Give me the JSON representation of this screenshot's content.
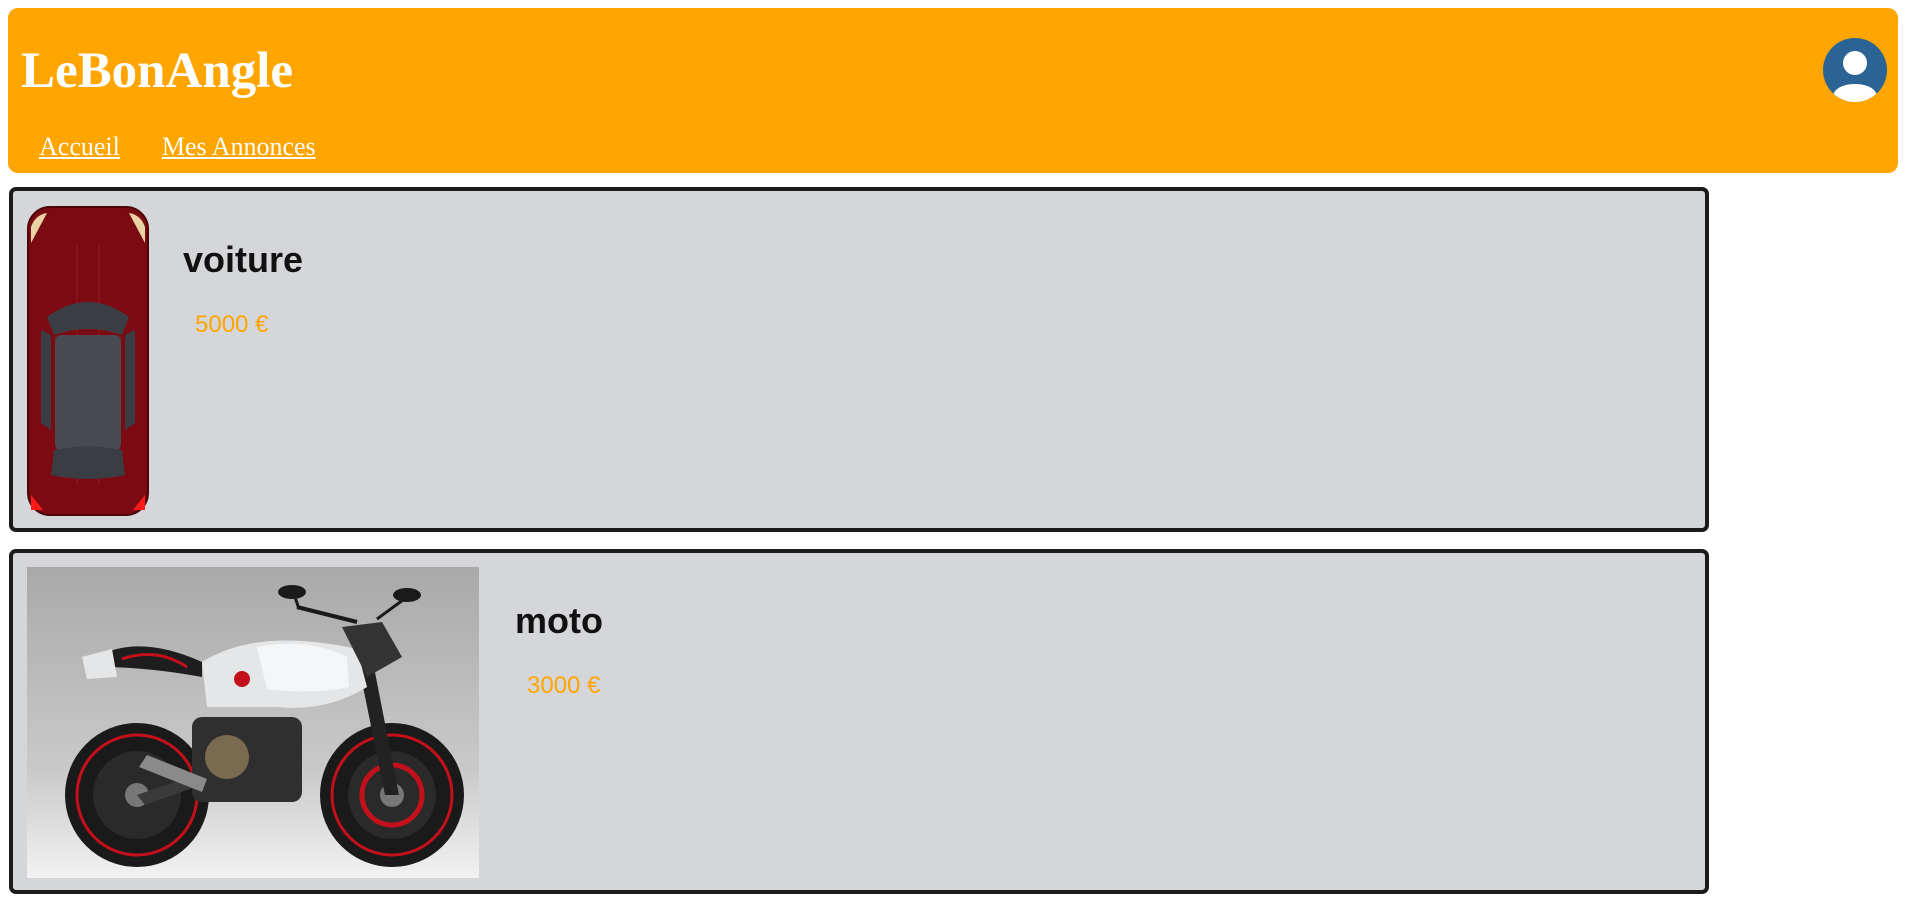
{
  "header": {
    "title": "LeBonAngle",
    "nav": [
      {
        "label": "Accueil"
      },
      {
        "label": "Mes Annonces"
      }
    ],
    "accent_color": "#ffa500",
    "avatar_icon": "user-avatar-icon"
  },
  "listings": [
    {
      "title": "voiture",
      "price": "5000 €",
      "image_icon": "car-image"
    },
    {
      "title": "moto",
      "price": "3000 €",
      "image_icon": "motorcycle-image"
    }
  ]
}
